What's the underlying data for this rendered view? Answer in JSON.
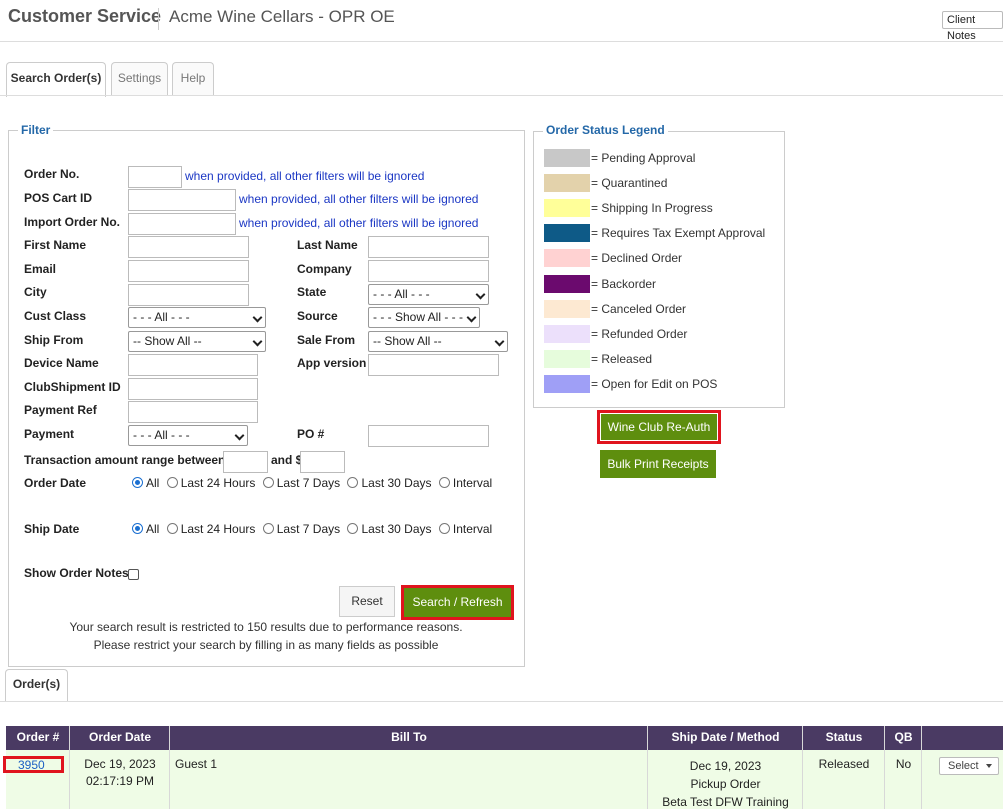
{
  "header": {
    "title": "Customer Service",
    "company": "Acme Wine Cellars - OPR OE",
    "client_notes": "Client Notes"
  },
  "tabs": [
    {
      "label": "Search Order(s)",
      "active": true
    },
    {
      "label": "Settings",
      "active": false
    },
    {
      "label": "Help",
      "active": false
    }
  ],
  "filter": {
    "legend": "Filter",
    "labels": {
      "order_no": "Order No.",
      "pos_cart_id": "POS Cart ID",
      "import_order_no": "Import Order No.",
      "first_name": "First Name",
      "last_name": "Last Name",
      "email": "Email",
      "company": "Company",
      "city": "City",
      "state": "State",
      "cust_class": "Cust Class",
      "source": "Source",
      "ship_from": "Ship From",
      "sale_from": "Sale From",
      "device_name": "Device Name",
      "app_version": "App version",
      "clubshipment_id": "ClubShipment ID",
      "payment_ref": "Payment Ref",
      "payment": "Payment",
      "po": "PO #",
      "txn_range": "Transaction amount range between: $",
      "and": "and $",
      "order_date": "Order Date",
      "ship_date": "Ship Date",
      "show_order_notes": "Show Order Notes"
    },
    "hint": "when provided, all other filters will be ignored",
    "selects": {
      "state": "- - - All - - -",
      "cust_class": "- - - All - - -",
      "source": "- - - Show All - - -",
      "ship_from": "-- Show All --",
      "sale_from": "-- Show All --",
      "payment": "- - - All - - -"
    },
    "date_options": [
      "All",
      "Last 24 Hours",
      "Last 7 Days",
      "Last 30 Days",
      "Interval"
    ],
    "reset": "Reset",
    "search": "Search / Refresh",
    "note_line1": "Your search result is restricted to 150 results due to performance reasons.",
    "note_line2": "Please restrict your search by filling in as many fields as possible"
  },
  "legend_panel": {
    "title": "Order Status Legend",
    "items": [
      {
        "label": "= Pending Approval",
        "color": "#c8c8c8"
      },
      {
        "label": "= Quarantined",
        "color": "#e3d2ab"
      },
      {
        "label": "= Shipping In Progress",
        "color": "#ffff99"
      },
      {
        "label": "= Requires Tax Exempt Approval",
        "color": "#0e5a87"
      },
      {
        "label": "= Declined Order",
        "color": "#ffd2d2"
      },
      {
        "label": "= Backorder",
        "color": "#6b0a6e"
      },
      {
        "label": "= Canceled Order",
        "color": "#fde9d2"
      },
      {
        "label": "= Refunded Order",
        "color": "#ece0fb"
      },
      {
        "label": "= Released",
        "color": "#e6fcdc"
      },
      {
        "label": "= Open for Edit on POS",
        "color": "#9f9ff6"
      }
    ],
    "wine_club_btn": "Wine Club Re-Auth",
    "bulk_print_btn": "Bulk Print Receipts"
  },
  "orders": {
    "tab": "Order(s)",
    "columns": [
      "Order #",
      "Order Date",
      "Bill To",
      "Ship Date / Method",
      "Status",
      "QB",
      ""
    ],
    "rows": [
      {
        "order_no": "3950",
        "date": "Dec 19, 2023",
        "time": "02:17:19 PM",
        "bill_to": "Guest 1",
        "ship_date": "Dec 19, 2023",
        "ship_method": "Pickup Order",
        "ship_location": "Beta Test DFW Training",
        "status": "Released",
        "qb": "No",
        "action": "Select"
      }
    ]
  }
}
